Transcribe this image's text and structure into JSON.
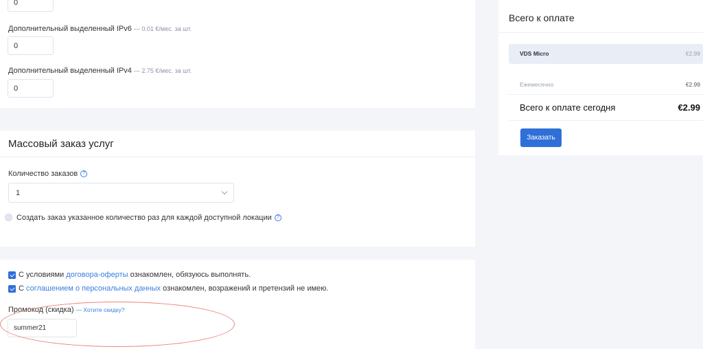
{
  "ip_section": {
    "top_input_value": "0",
    "ipv6": {
      "label": "Дополнительный выделенный IPv6",
      "price": "— 0.01 €/мес. за шт.",
      "value": "0"
    },
    "ipv4": {
      "label": "Дополнительный выделенный IPv4",
      "price": "— 2.75 €/мес. за шт.",
      "value": "0"
    }
  },
  "mass_order": {
    "title": "Массовый заказ услуг",
    "quantity_label": "Количество заказов",
    "quantity_value": "1",
    "per_location_label": "Создать заказ указанное количество раз для каждой доступной локации",
    "help_glyph": "?"
  },
  "terms": {
    "offer_prefix": "С условиями ",
    "offer_link": "договора-оферты",
    "offer_suffix": " ознакомлен, обязуюсь выполнять.",
    "privacy_prefix": "С ",
    "privacy_link": "соглашением о персональных данных",
    "privacy_suffix": " ознакомлен, возражений и претензий не имею.",
    "promo_label": "Промокод (скидка)",
    "promo_link": "— Хотите скидку?",
    "promo_value": "summer21"
  },
  "summary": {
    "title": "Всего к оплате",
    "product_name": "VDS Micro",
    "product_price": "€2.99",
    "period_label": "Ежемесячно",
    "period_price": "€2.99",
    "total_label": "Всего к оплате сегодня",
    "total_price": "€2.99",
    "order_button": "Заказать"
  },
  "colors": {
    "accent": "#2f6fd8",
    "link": "#3b7de0",
    "annotation": "#e9857d",
    "background": "#f4f5f9"
  }
}
